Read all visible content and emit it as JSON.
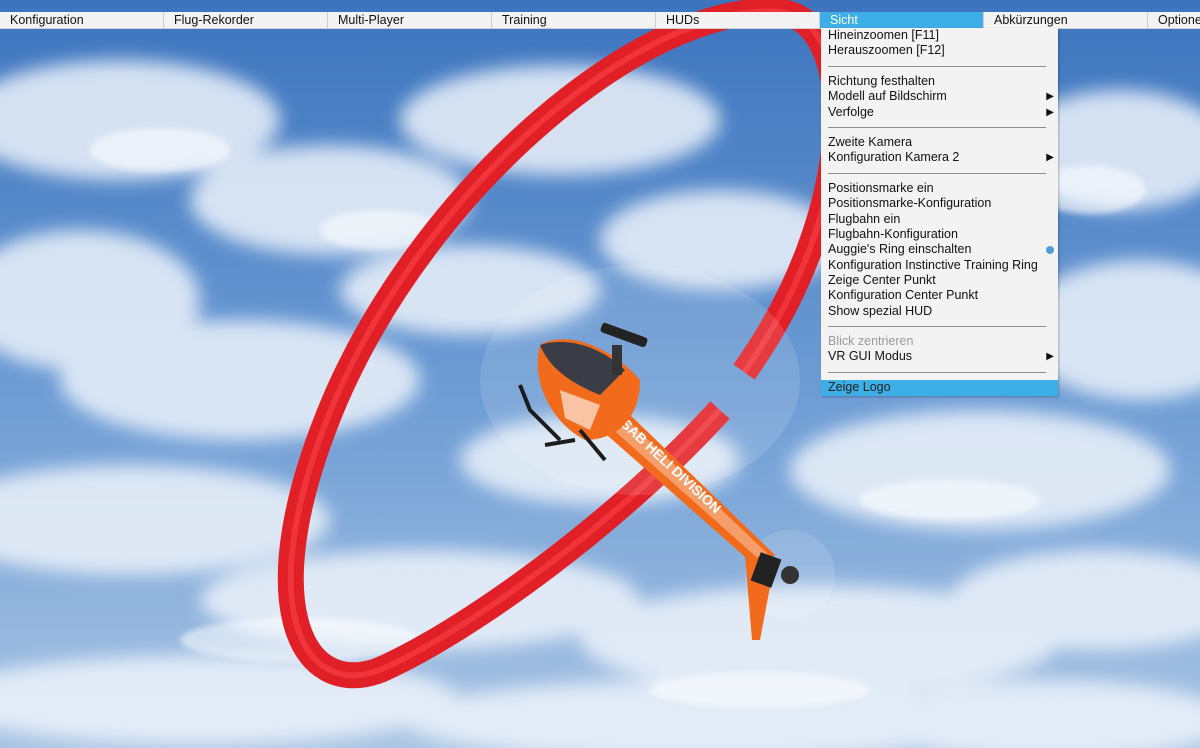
{
  "colors": {
    "menu_bg": "#f3f3f3",
    "menu_highlight": "#3eaee6",
    "ring_red": "#e11f26",
    "heli_orange": "#f26a1b",
    "heli_dark": "#3a3d46",
    "sky_blue": "#4f83c4"
  },
  "menubar": {
    "items": [
      {
        "label": "Konfiguration"
      },
      {
        "label": "Flug-Rekorder"
      },
      {
        "label": "Multi-Player"
      },
      {
        "label": "Training"
      },
      {
        "label": "HUDs"
      },
      {
        "label": "Sicht"
      },
      {
        "label": "Abkürzungen"
      },
      {
        "label": "Optionen"
      }
    ],
    "active_label": "Sicht"
  },
  "sicht_menu": {
    "items": [
      {
        "label": "Hineinzoomen [F11]"
      },
      {
        "label": "Herauszoomen [F12]"
      },
      {
        "label": "Richtung festhalten"
      },
      {
        "label": "Modell auf Bildschirm",
        "submenu_icon": "triangle-right-icon"
      },
      {
        "label": "Verfolge",
        "submenu_icon": "triangle-right-icon"
      },
      {
        "label": "Zweite Kamera"
      },
      {
        "label": "Konfiguration Kamera 2",
        "submenu_icon": "triangle-right-icon"
      },
      {
        "label": "Positionsmarke ein"
      },
      {
        "label": "Positionsmarke-Konfiguration"
      },
      {
        "label": "Flugbahn ein"
      },
      {
        "label": "Flugbahn-Konfiguration"
      },
      {
        "label": "Auggie's Ring einschalten",
        "state_icon": "radio-dot-icon",
        "checked": true
      },
      {
        "label": "Konfiguration Instinctive Training Ring"
      },
      {
        "label": "Zeige Center Punkt"
      },
      {
        "label": "Konfiguration Center Punkt"
      },
      {
        "label": "Show spezial HUD"
      },
      {
        "label": "Blick zentrieren",
        "disabled": true
      },
      {
        "label": "VR GUI Modus",
        "submenu_icon": "triangle-right-icon"
      },
      {
        "label": "Zeige Logo",
        "highlighted": true
      }
    ]
  },
  "scene": {
    "heli_boom_text": "SAB HELI DIVISION",
    "heli_icon": "helicopter-icon",
    "ring_icon": "training-ring-icon"
  }
}
